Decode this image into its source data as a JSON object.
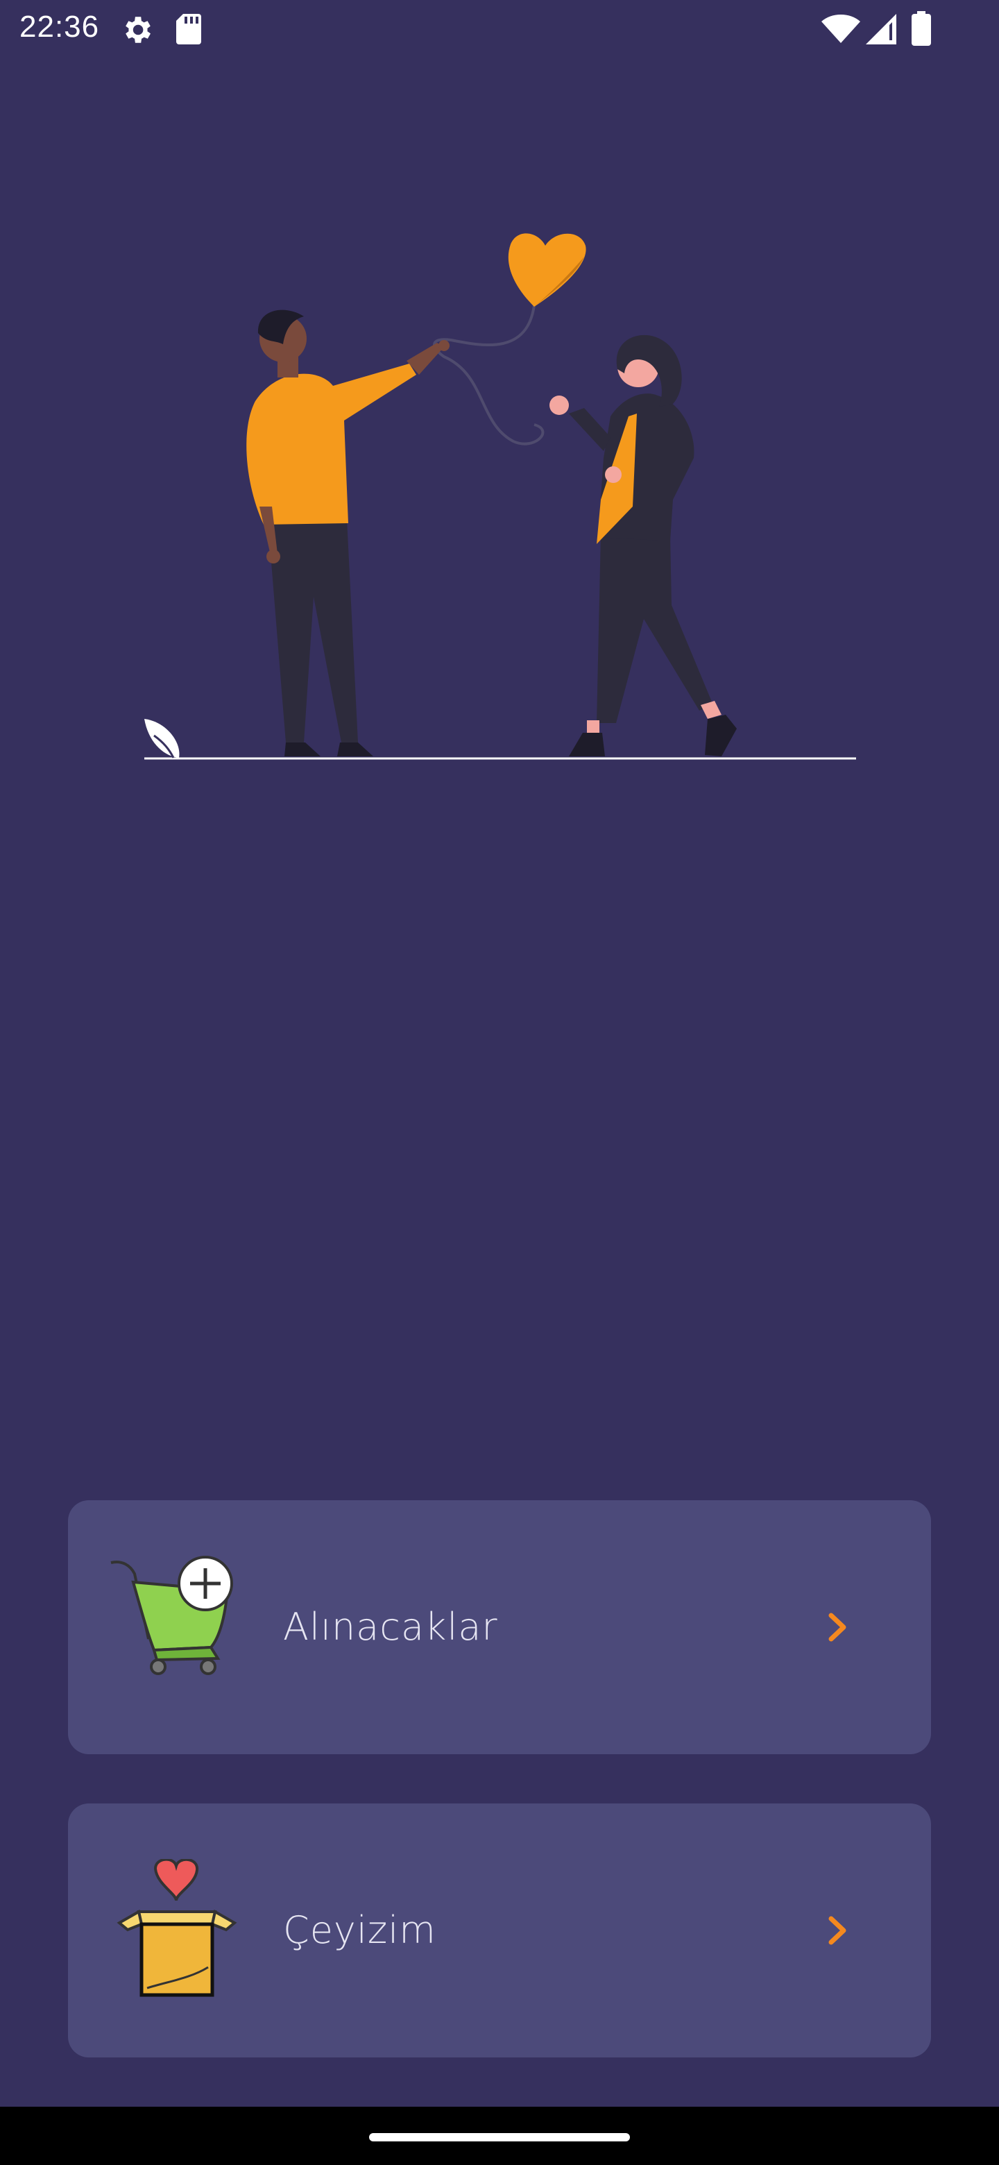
{
  "status_bar": {
    "time": "22:36",
    "left_icons": [
      "settings-gear-icon",
      "sd-card-icon"
    ],
    "right_icons": [
      "wifi-icon",
      "cellular-signal-icon",
      "battery-icon"
    ]
  },
  "illustration": {
    "subject": "couple-with-heart-balloon-icon",
    "colors": {
      "accent": "#f59a1c",
      "dark_clothes": "#2d2b3c",
      "ground": "#ffffff"
    }
  },
  "menu": {
    "items": [
      {
        "label": "Alınacaklar",
        "icon": "shopping-cart-add-icon",
        "chevron": "chevron-right-icon"
      },
      {
        "label": "Çeyizim",
        "icon": "gift-box-heart-icon",
        "chevron": "chevron-right-icon"
      }
    ]
  },
  "colors": {
    "background": "#36305e",
    "card": "#4c4a7a",
    "label_text": "#e6e5f2",
    "chevron": "#f5891f"
  }
}
